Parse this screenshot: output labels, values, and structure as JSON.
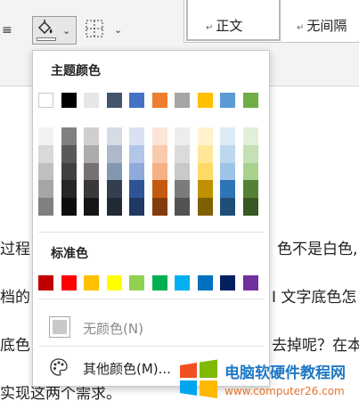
{
  "ribbon": {
    "partial_glyph": "≡",
    "shading_arrow": "⌄",
    "border_arrow": "⌄",
    "styles": [
      {
        "label": "正文",
        "mark": "↵",
        "selected": true
      },
      {
        "label": "无间隔",
        "mark": "↵",
        "selected": false
      }
    ]
  },
  "document": {
    "lines": [
      {
        "left": "过程",
        "right": "色不是白色,"
      },
      {
        "left": "档的",
        "right": "I 文字底色怎"
      },
      {
        "left": "底色",
        "right": "去掉呢？在本"
      },
      {
        "left": "实现这两个需求。",
        "right": ""
      }
    ]
  },
  "popup": {
    "theme_title": "主题颜色",
    "standard_title": "标准色",
    "theme_colors": [
      "#ffffff",
      "#000000",
      "#e7e6e6",
      "#44546a",
      "#4472c4",
      "#ed7d31",
      "#a5a5a5",
      "#ffc000",
      "#5b9bd5",
      "#70ad47"
    ],
    "theme_shades": [
      [
        "#f2f2f2",
        "#d9d9d9",
        "#bfbfbf",
        "#a6a6a6",
        "#808080"
      ],
      [
        "#808080",
        "#595959",
        "#404040",
        "#262626",
        "#0d0d0d"
      ],
      [
        "#d0cece",
        "#aeabab",
        "#757171",
        "#3a3838",
        "#171616"
      ],
      [
        "#d6dce4",
        "#adb9ca",
        "#8497b0",
        "#333f4f",
        "#222a35"
      ],
      [
        "#d9e2f3",
        "#b4c6e7",
        "#8eaadb",
        "#2f5496",
        "#1f3864"
      ],
      [
        "#fbe5d6",
        "#f8cbad",
        "#f4b183",
        "#c55a11",
        "#843c0c"
      ],
      [
        "#ededed",
        "#dbdbdb",
        "#c9c9c9",
        "#7b7b7b",
        "#525252"
      ],
      [
        "#fff2cc",
        "#ffe699",
        "#ffd966",
        "#bf9000",
        "#7f6000"
      ],
      [
        "#deebf7",
        "#bdd7ee",
        "#9dc3e6",
        "#2e75b6",
        "#1f4e79"
      ],
      [
        "#e2f0d9",
        "#c5e0b4",
        "#a9d18e",
        "#548235",
        "#385723"
      ]
    ],
    "standard_colors": [
      "#c00000",
      "#ff0000",
      "#ffc000",
      "#ffff00",
      "#92d050",
      "#00b050",
      "#00b0f0",
      "#0070c0",
      "#002060",
      "#7030a0"
    ],
    "no_color_label": "无颜色(N)",
    "more_colors_label": "其他颜色(M)..."
  },
  "watermark": {
    "title": "电脑软硬件教程网",
    "url": "www.computer26.com"
  }
}
